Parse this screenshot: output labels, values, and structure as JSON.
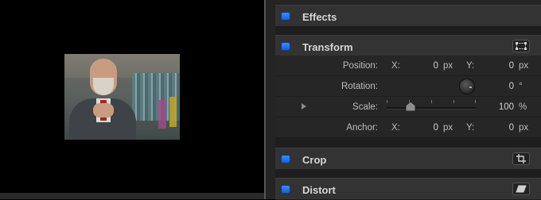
{
  "inspector": {
    "sections": {
      "effects": {
        "label": "Effects"
      },
      "transform": {
        "label": "Transform",
        "button_icon": "transform-onscreen-icon"
      },
      "crop": {
        "label": "Crop",
        "button_icon": "crop-onscreen-icon"
      },
      "distort": {
        "label": "Distort",
        "button_icon": "distort-onscreen-icon"
      }
    },
    "transform_params": {
      "position": {
        "label": "Position:",
        "x_label": "X:",
        "x_value": "0",
        "x_unit": "px",
        "y_label": "Y:",
        "y_value": "0",
        "y_unit": "px"
      },
      "rotation": {
        "label": "Rotation:",
        "value": "0",
        "unit": "°"
      },
      "scale": {
        "label": "Scale:",
        "value": "100",
        "unit": "%"
      },
      "anchor": {
        "label": "Anchor:",
        "x_label": "X:",
        "x_value": "0",
        "x_unit": "px",
        "y_label": "Y:",
        "y_value": "0",
        "y_unit": "px"
      }
    }
  },
  "colors": {
    "checkbox": "#2f7ff0",
    "panel": "#242424",
    "header": "#333333"
  }
}
